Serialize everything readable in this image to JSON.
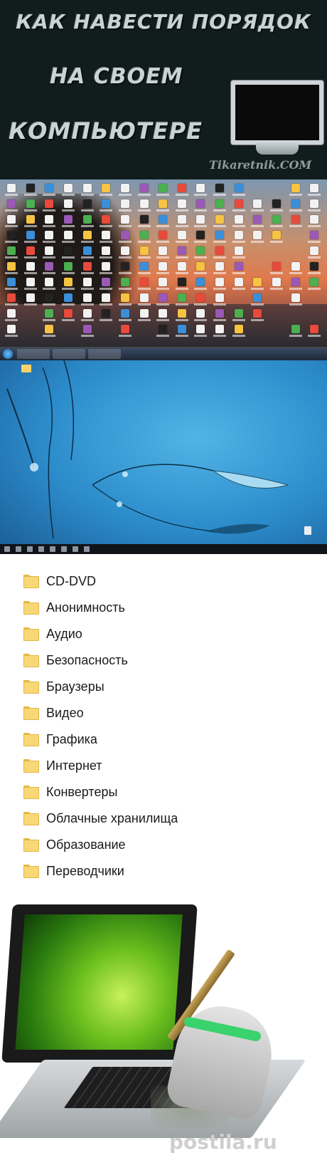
{
  "banner": {
    "title_line1": "КАК НАВЕСТИ ПОРЯДОК",
    "title_line2": "НА СВОЕМ",
    "title_line3": "КОМПЬЮТЕРЕ",
    "watermark": "Tikaretnik.COM"
  },
  "desktop_cluttered": {
    "description_icons": "monitor-icon"
  },
  "desktop_clean": {},
  "folders": [
    {
      "label": "CD-DVD"
    },
    {
      "label": "Анонимность"
    },
    {
      "label": "Аудио"
    },
    {
      "label": "Безопасность"
    },
    {
      "label": "Браузеры"
    },
    {
      "label": "Видео"
    },
    {
      "label": "Графика"
    },
    {
      "label": "Интернет"
    },
    {
      "label": "Конвертеры"
    },
    {
      "label": "Облачные хранилища"
    },
    {
      "label": "Образование"
    },
    {
      "label": "Переводчики"
    }
  ],
  "footer": {
    "site_mark": "postila.ru"
  },
  "colors": {
    "banner_bg": "#111d1d",
    "folder_yellow": "#f8d776",
    "broom_band": "#3ad26c"
  }
}
